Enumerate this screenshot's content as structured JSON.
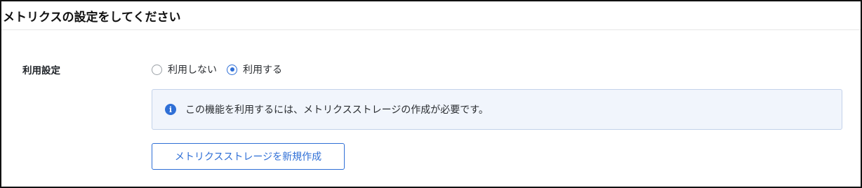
{
  "panel": {
    "title": "メトリクスの設定をしてください"
  },
  "usage_setting": {
    "label": "利用設定",
    "options": [
      {
        "label": "利用しない",
        "selected": false
      },
      {
        "label": "利用する",
        "selected": true
      }
    ]
  },
  "info": {
    "icon": "info-circle-icon",
    "message": "この機能を利用するには、メトリクスストレージの作成が必要です。"
  },
  "actions": {
    "create_storage_label": "メトリクスストレージを新規作成"
  },
  "colors": {
    "accent": "#2f6fd6",
    "info_background": "#f1f5fc",
    "info_border": "#c3d2ea"
  }
}
